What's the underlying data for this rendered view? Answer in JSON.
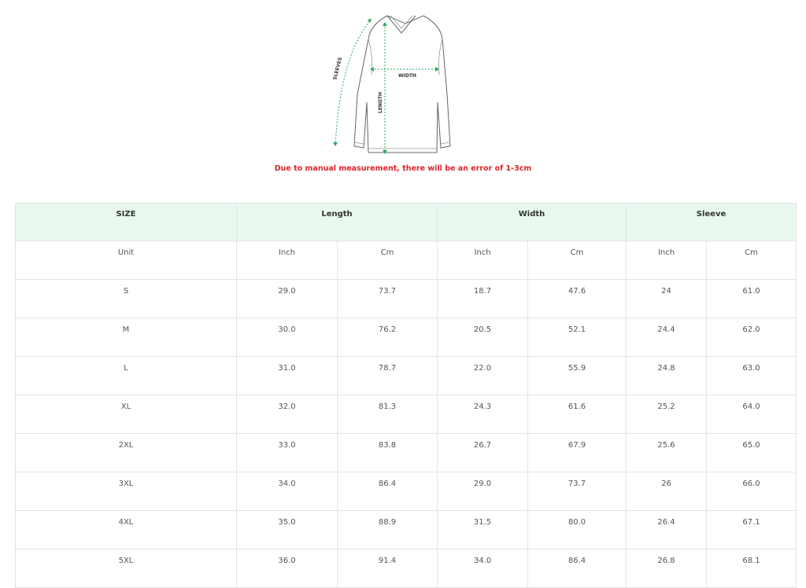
{
  "diagram": {
    "labels": {
      "sleeves": "SLEEVES",
      "width": "WIDTH",
      "length": "LENGTH"
    },
    "accent_color": "#2eab5c"
  },
  "note": "Due to manual measurement, there will be an error of 1-3cm",
  "table": {
    "header": {
      "size": "SIZE",
      "length": "Length",
      "width": "Width",
      "sleeve": "Sleeve"
    },
    "unit_row": [
      "Unit",
      "Inch",
      "Cm",
      "Inch",
      "Cm",
      "Inch",
      "Cm"
    ],
    "rows": [
      [
        "S",
        "29.0",
        "73.7",
        "18.7",
        "47.6",
        "24",
        "61.0"
      ],
      [
        "M",
        "30.0",
        "76.2",
        "20.5",
        "52.1",
        "24.4",
        "62.0"
      ],
      [
        "L",
        "31.0",
        "78.7",
        "22.0",
        "55.9",
        "24.8",
        "63.0"
      ],
      [
        "XL",
        "32.0",
        "81.3",
        "24.3",
        "61.6",
        "25.2",
        "64.0"
      ],
      [
        "2XL",
        "33.0",
        "83.8",
        "26.7",
        "67.9",
        "25.6",
        "65.0"
      ],
      [
        "3XL",
        "34.0",
        "86.4",
        "29.0",
        "73.7",
        "26",
        "66.0"
      ],
      [
        "4XL",
        "35.0",
        "88.9",
        "31.5",
        "80.0",
        "26.4",
        "67.1"
      ],
      [
        "5XL",
        "36.0",
        "91.4",
        "34.0",
        "86.4",
        "26.8",
        "68.1"
      ]
    ],
    "header_bg": "#e8f8ef"
  }
}
